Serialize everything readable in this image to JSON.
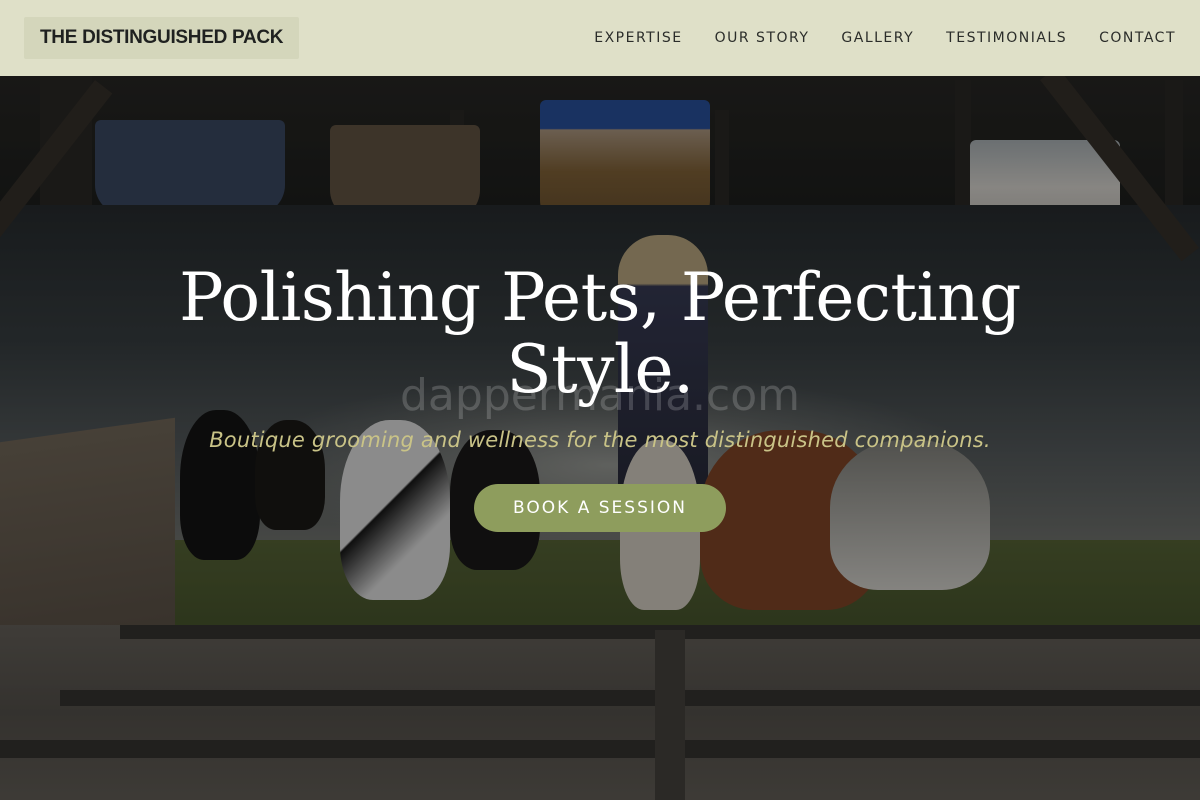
{
  "header": {
    "brand": "THE DISTINGUISHED PACK",
    "nav": [
      {
        "label": "EXPERTISE"
      },
      {
        "label": "OUR STORY"
      },
      {
        "label": "GALLERY"
      },
      {
        "label": "TESTIMONIALS"
      },
      {
        "label": "CONTACT"
      }
    ]
  },
  "hero": {
    "title": "Polishing Pets, Perfecting Style.",
    "watermark": "dappermania.com",
    "subtitle": "Boutique grooming and wellness for the most distinguished companions.",
    "cta_label": "BOOK A SESSION"
  },
  "colors": {
    "header_bg": "#dfe0c8",
    "brand_bg": "#d4d6bb",
    "cta_bg": "#8e9d5d",
    "subtitle": "#c9c387"
  }
}
